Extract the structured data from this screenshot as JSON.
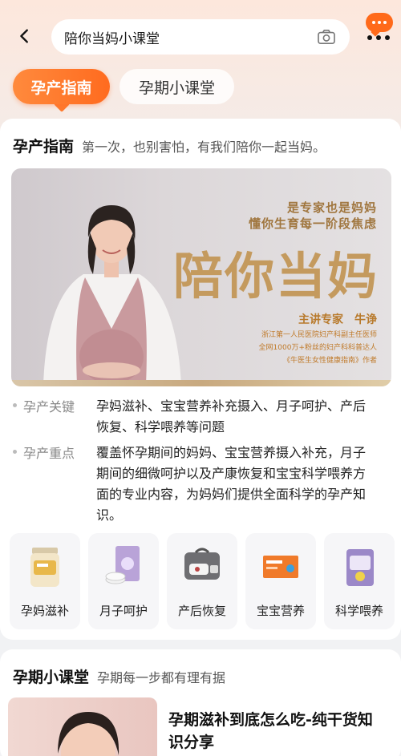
{
  "search": {
    "query": "陪你当妈小课堂"
  },
  "icons": {
    "back": "back-arrow-icon",
    "camera": "camera-icon",
    "more": "more-icon"
  },
  "colors": {
    "accent": "#ff6b1f",
    "gold": "#c49a5e"
  },
  "tabs": [
    {
      "label": "孕产指南",
      "active": true
    },
    {
      "label": "孕期小课堂",
      "active": false
    }
  ],
  "guide": {
    "title": "孕产指南",
    "subtitle": "第一次，也别害怕，有我们陪你一起当妈。",
    "banner": {
      "tag1": "是专家也是妈妈",
      "tag2": "懂你生育每一阶段焦虑",
      "title": "陪你当妈",
      "expert": "主讲专家　牛诤",
      "line1": "浙江第一人民医院妇产科副主任医师",
      "line2": "全网1000万+粉丝的妇产科科普达人",
      "line3": "《牛医生女性健康指南》作者"
    },
    "info": [
      {
        "label": "孕产关键",
        "text": "孕妈滋补、宝宝营养补充摄入、月子呵护、产后恢复、科学喂养等问题"
      },
      {
        "label": "孕产重点",
        "text": "覆盖怀孕期间的妈妈、宝宝营养摄入补充，月子期间的细微呵护以及产康恢复和宝宝科学喂养方面的专业内容，为妈妈们提供全面科学的孕产知识。"
      }
    ],
    "categories": [
      {
        "label": "孕妈滋补",
        "icon": "milk-powder-can-icon"
      },
      {
        "label": "月子呵护",
        "icon": "maternity-pads-icon"
      },
      {
        "label": "产后恢复",
        "icon": "recovery-device-icon"
      },
      {
        "label": "宝宝营养",
        "icon": "nutrition-box-icon"
      },
      {
        "label": "科学喂养",
        "icon": "diaper-pack-icon"
      }
    ]
  },
  "classroom": {
    "title": "孕期小课堂",
    "subtitle": "孕期每一步都有理有据",
    "lesson": {
      "title": "孕期滋补到底怎么吃-纯干货知识分享"
    }
  }
}
